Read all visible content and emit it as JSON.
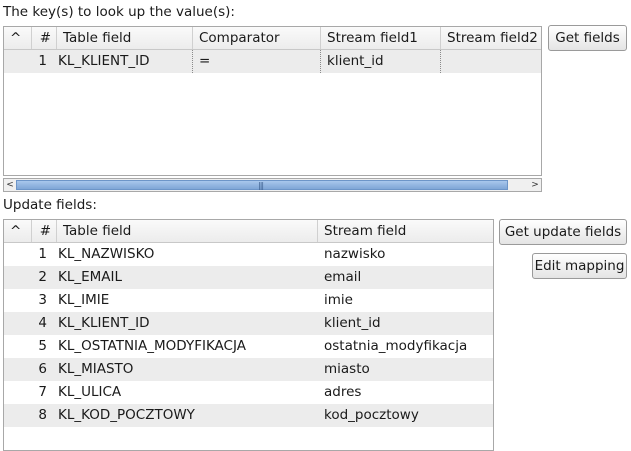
{
  "keys_section": {
    "label": "The key(s) to look up the value(s):",
    "columns": {
      "sort": "^",
      "num": "#",
      "table_field": "Table field",
      "comparator": "Comparator",
      "stream_field1": "Stream field1",
      "stream_field2": "Stream field2"
    },
    "rows": [
      {
        "num": "1",
        "table_field": "KL_KLIENT_ID",
        "comparator": "=",
        "stream_field1": "klient_id",
        "stream_field2": ""
      }
    ],
    "get_fields_button": "Get fields"
  },
  "update_section": {
    "label": "Update fields:",
    "columns": {
      "sort": "^",
      "num": "#",
      "table_field": "Table field",
      "stream_field": "Stream field"
    },
    "rows": [
      {
        "num": "1",
        "table_field": "KL_NAZWISKO",
        "stream_field": "nazwisko"
      },
      {
        "num": "2",
        "table_field": "KL_EMAIL",
        "stream_field": "email"
      },
      {
        "num": "3",
        "table_field": "KL_IMIE",
        "stream_field": "imie"
      },
      {
        "num": "4",
        "table_field": "KL_KLIENT_ID",
        "stream_field": "klient_id"
      },
      {
        "num": "5",
        "table_field": "KL_OSTATNIA_MODYFIKACJA",
        "stream_field": "ostatnia_modyfikacja"
      },
      {
        "num": "6",
        "table_field": "KL_MIASTO",
        "stream_field": "miasto"
      },
      {
        "num": "7",
        "table_field": "KL_ULICA",
        "stream_field": "adres"
      },
      {
        "num": "8",
        "table_field": "KL_KOD_POCZTOWY",
        "stream_field": "kod_pocztowy"
      }
    ],
    "get_update_fields_button": "Get update fields",
    "edit_mapping_button": "Edit mapping"
  },
  "scrollbar": {
    "left_arrow": "<",
    "right_arrow": ">",
    "grip": "|||"
  }
}
